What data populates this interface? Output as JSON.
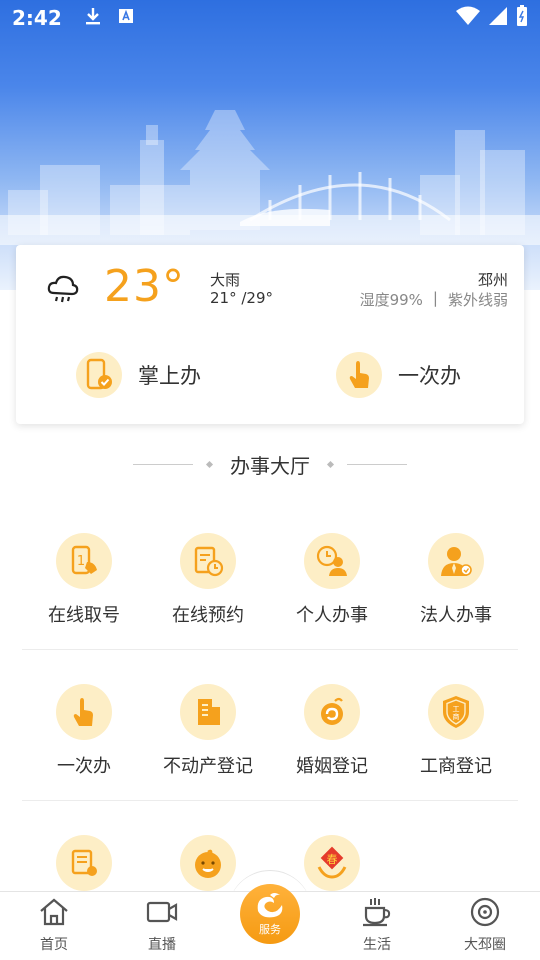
{
  "status_bar": {
    "time": "2:42",
    "left_icons": [
      "download-icon",
      "font-icon"
    ],
    "right_icons": [
      "wifi-icon",
      "signal-icon",
      "battery-icon"
    ]
  },
  "weather": {
    "icon": "rain-cloud-icon",
    "temperature": "23°",
    "description": "大雨",
    "temp_range": "21° /29°",
    "city": "邳州",
    "humidity": "湿度99%",
    "separator": "|",
    "uv": "紫外线弱"
  },
  "quick_actions": [
    {
      "label": "掌上办",
      "icon": "phone-check-icon"
    },
    {
      "label": "一次办",
      "icon": "finger-tap-icon"
    }
  ],
  "section": {
    "title": "办事大厅"
  },
  "services_row1": [
    {
      "label": "在线取号",
      "icon": "take-number-icon"
    },
    {
      "label": "在线预约",
      "icon": "appointment-icon"
    },
    {
      "label": "个人办事",
      "icon": "person-affairs-icon"
    },
    {
      "label": "法人办事",
      "icon": "legal-person-icon"
    }
  ],
  "services_row2": [
    {
      "label": "一次办",
      "icon": "finger-tap-icon"
    },
    {
      "label": "不动产登记",
      "icon": "real-estate-icon"
    },
    {
      "label": "婚姻登记",
      "icon": "marriage-icon"
    },
    {
      "label": "工商登记",
      "icon": "business-shield-icon"
    }
  ],
  "services_row3": [
    {
      "label": "",
      "icon": "document-coin-icon"
    },
    {
      "label": "",
      "icon": "baby-face-icon"
    },
    {
      "label": "",
      "icon": "spring-festival-icon"
    }
  ],
  "bottom_nav": {
    "home": "首页",
    "live": "直播",
    "service": "服务",
    "life": "生活",
    "circle": "大邳圈"
  },
  "colors": {
    "accent": "#f5a11d",
    "icon_bg": "#fdeec6",
    "hero_top": "#2e6fe0"
  }
}
